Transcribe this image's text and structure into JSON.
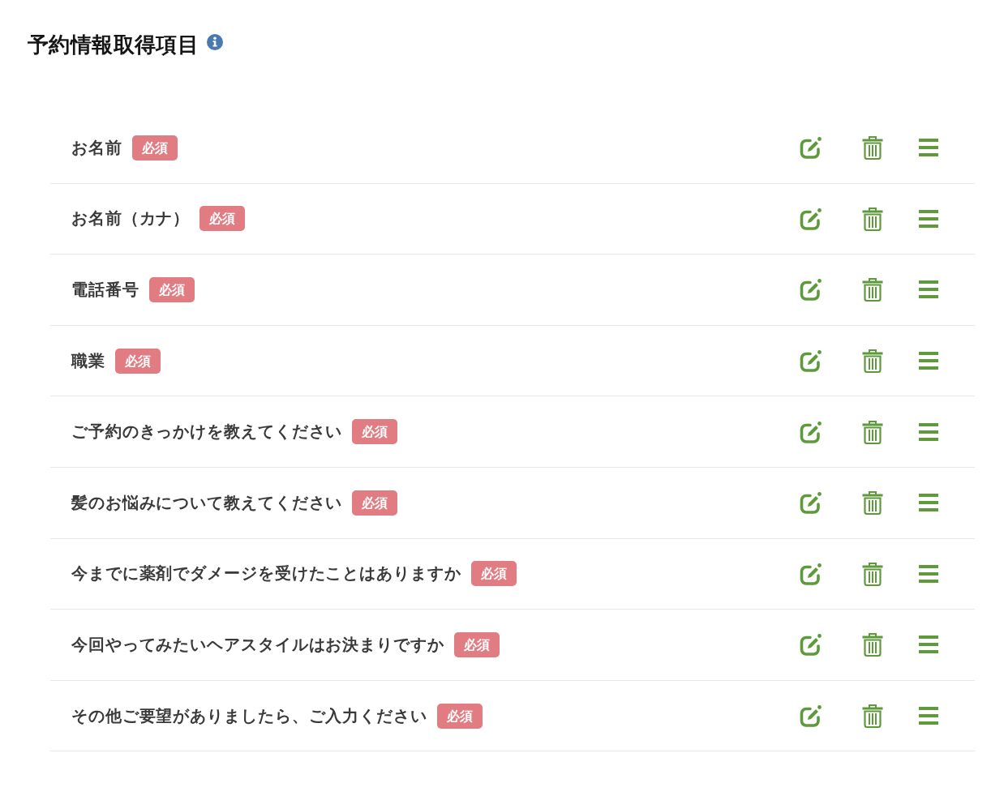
{
  "header": {
    "title": "予約情報取得項目"
  },
  "fields": [
    {
      "label": "お名前",
      "badge": "必須"
    },
    {
      "label": "お名前（カナ）",
      "badge": "必須"
    },
    {
      "label": "電話番号",
      "badge": "必須"
    },
    {
      "label": "職業",
      "badge": "必須"
    },
    {
      "label": "ご予約のきっかけを教えてください",
      "badge": "必須"
    },
    {
      "label": "髪のお悩みについて教えてください",
      "badge": "必須"
    },
    {
      "label": "今までに薬剤でダメージを受けたことはありますか",
      "badge": "必須"
    },
    {
      "label": "今回やってみたいヘアスタイルはお決まりですか",
      "badge": "必須"
    },
    {
      "label": "その他ご要望がありましたら、ご入力ください",
      "badge": "必須"
    }
  ]
}
